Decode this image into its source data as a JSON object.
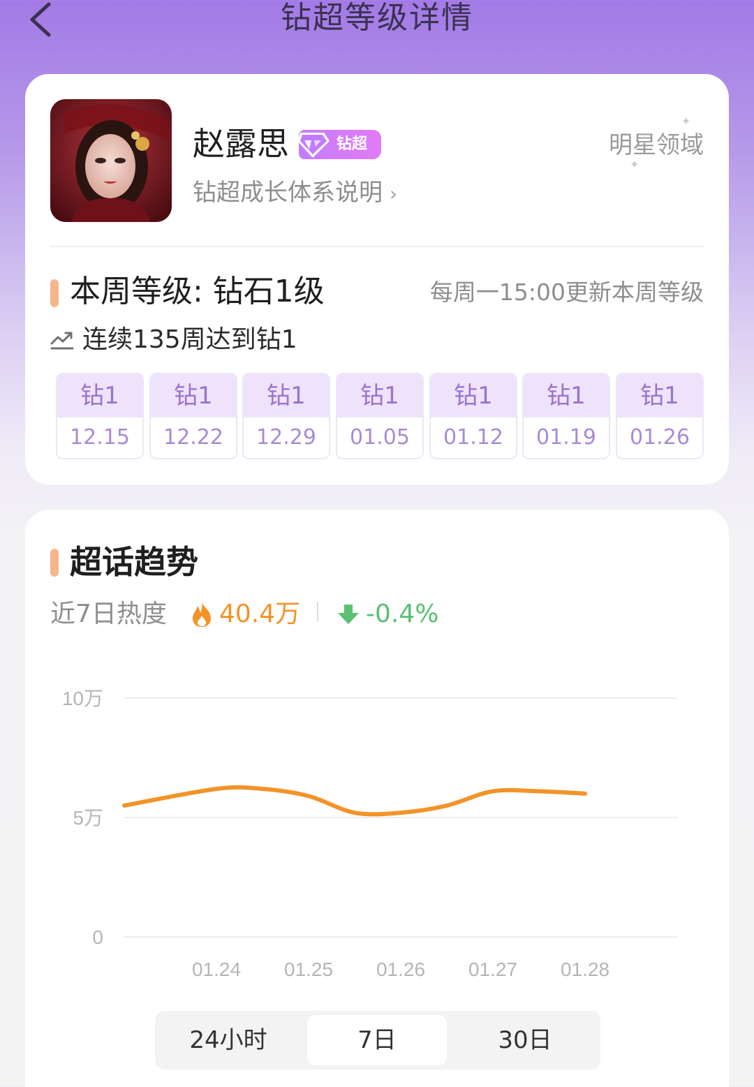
{
  "header": {
    "title": "钻超等级详情"
  },
  "profile": {
    "name": "赵露思",
    "badge_label": "钻超",
    "explain_link": "钻超成长体系说明",
    "domain_label": "明星领域"
  },
  "level": {
    "title": "本周等级: 钻石1级",
    "update_note": "每周一15:00更新本周等级",
    "streak": "连续135周达到钻1",
    "weeks": [
      {
        "level": "钻1",
        "date": "12.15"
      },
      {
        "level": "钻1",
        "date": "12.22"
      },
      {
        "level": "钻1",
        "date": "12.29"
      },
      {
        "level": "钻1",
        "date": "01.05"
      },
      {
        "level": "钻1",
        "date": "01.12"
      },
      {
        "level": "钻1",
        "date": "01.19"
      },
      {
        "level": "钻1",
        "date": "01.26"
      }
    ]
  },
  "trend": {
    "title": "超话趋势",
    "heat_label": "近7日热度",
    "heat_value": "40.4万",
    "change_value": "-0.4%",
    "range_tabs": [
      "24小时",
      "7日",
      "30日"
    ],
    "selected_tab": "7日"
  },
  "colors": {
    "accent": "#f39328",
    "brand_purple": "#a27ae6",
    "down_green": "#58c172",
    "line": "#f39328"
  },
  "chart_data": {
    "type": "line",
    "x": [
      "01.24",
      "01.25",
      "01.26",
      "01.27",
      "01.28"
    ],
    "y_tick_labels": [
      "0",
      "5万",
      "10万"
    ],
    "ylim": [
      0,
      100000
    ],
    "series": [
      {
        "x": [
          0.0,
          1.0,
          1.5,
          2.0,
          2.5,
          3.0,
          3.5,
          4.0,
          4.5,
          5.0
        ],
        "values": [
          55000,
          62000,
          62000,
          59000,
          52000,
          52000,
          55000,
          61000,
          61000,
          60000
        ]
      }
    ],
    "grid": true
  }
}
